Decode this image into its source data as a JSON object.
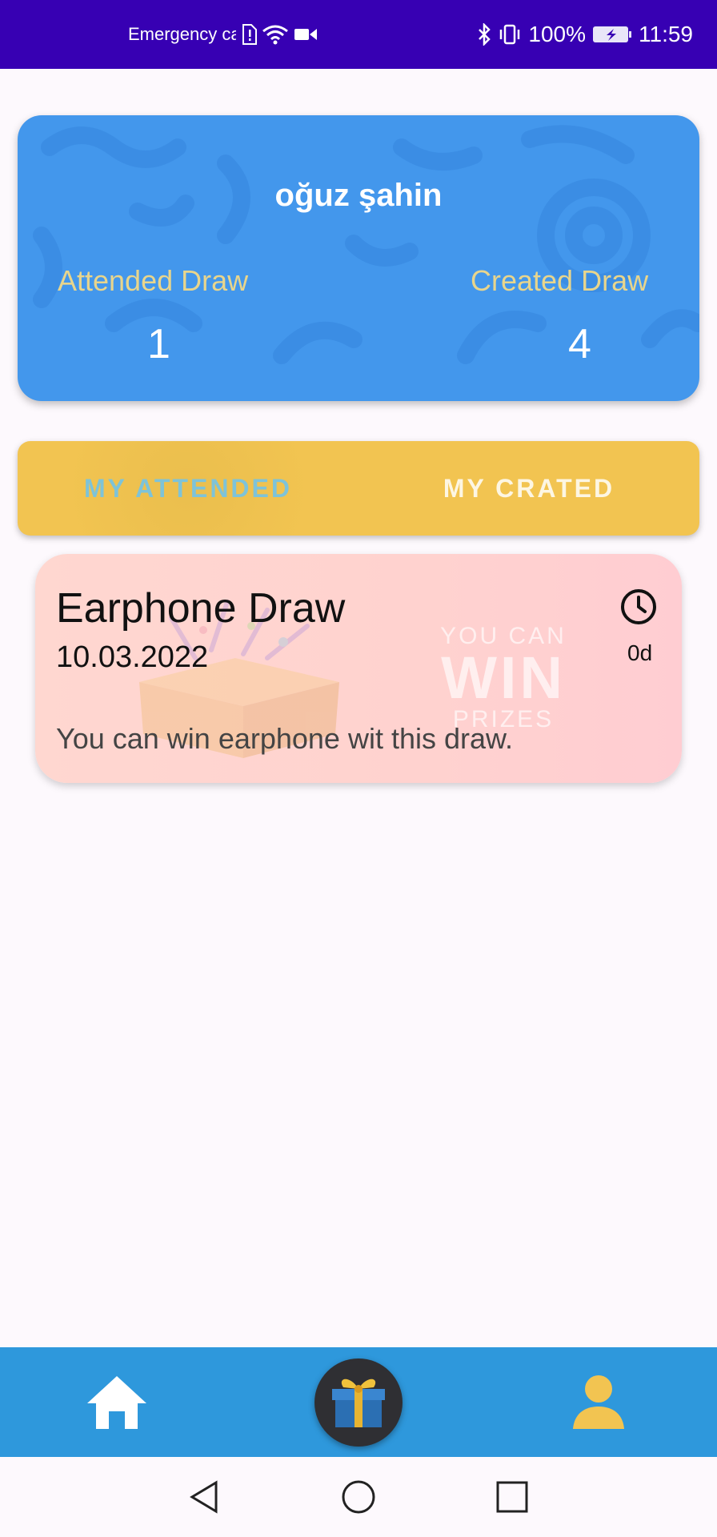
{
  "status_bar": {
    "carrier": "Emergency calls only",
    "battery": "100%",
    "time": "11:59"
  },
  "profile": {
    "name": "oğuz şahin",
    "attended_label": "Attended Draw",
    "attended_value": "1",
    "created_label": "Created Draw",
    "created_value": "4"
  },
  "tabs": [
    {
      "label": "MY ATTENDED",
      "selected": true
    },
    {
      "label": "MY CRATED",
      "selected": false
    }
  ],
  "draws": [
    {
      "title": "Earphone Draw",
      "date": "10.03.2022",
      "remaining": "0d",
      "description": "You can win earphone wit this draw.",
      "badge": {
        "top": "YOU CAN",
        "main": "WIN",
        "bottom": "PRIZES"
      }
    }
  ],
  "bottom_nav": {
    "items": [
      {
        "icon": "home-icon"
      },
      {
        "icon": "gift-icon"
      },
      {
        "icon": "person-icon"
      }
    ]
  },
  "colors": {
    "status_bar": "#3700b3",
    "profile_card": "#4397ec",
    "tabs": "#f2c451",
    "bottom_nav": "#2e98dc"
  }
}
